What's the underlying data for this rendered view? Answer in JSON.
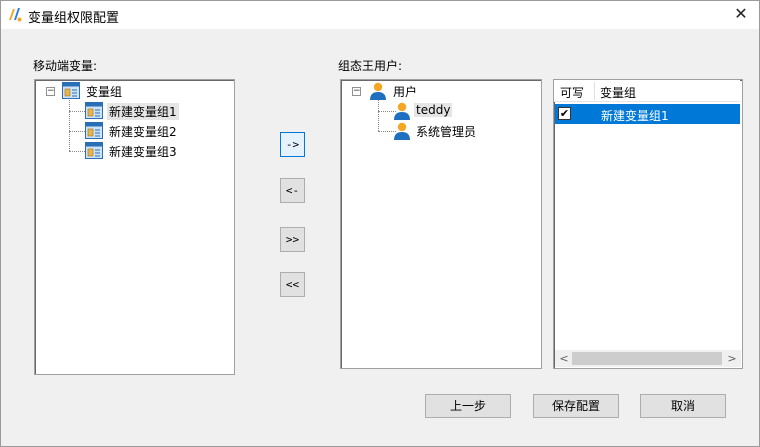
{
  "window": {
    "title": "变量组权限配置",
    "close_glyph": "✕"
  },
  "left": {
    "label": "移动端变量:",
    "tree": {
      "root": {
        "label": "变量组",
        "icon": "variable-group-icon"
      },
      "children": [
        {
          "label": "新建变量组1",
          "icon": "variable-group-icon",
          "selected": true
        },
        {
          "label": "新建变量组2",
          "icon": "variable-group-icon"
        },
        {
          "label": "新建变量组3",
          "icon": "variable-group-icon"
        }
      ]
    }
  },
  "transfer_buttons": [
    "->",
    "<-",
    ">>",
    "<<"
  ],
  "right": {
    "label": "组态王用户:",
    "tree": {
      "root": {
        "label": "用户",
        "icon": "user-icon"
      },
      "children": [
        {
          "label": "teddy",
          "icon": "user-icon",
          "selected": true
        },
        {
          "label": "系统管理员",
          "icon": "user-icon"
        }
      ]
    },
    "grid": {
      "columns": [
        "可写",
        "变量组"
      ],
      "rows": [
        {
          "writable": true,
          "group": "新建变量组1"
        }
      ],
      "check_glyph": "✔",
      "scroll_left": "<",
      "scroll_right": ">"
    }
  },
  "footer": {
    "prev": "上一步",
    "save": "保存配置",
    "cancel": "取消"
  },
  "colors": {
    "selection": "#0078d7",
    "user_icon_head": "#f5a623",
    "user_icon_body": "#1e6fbf"
  }
}
